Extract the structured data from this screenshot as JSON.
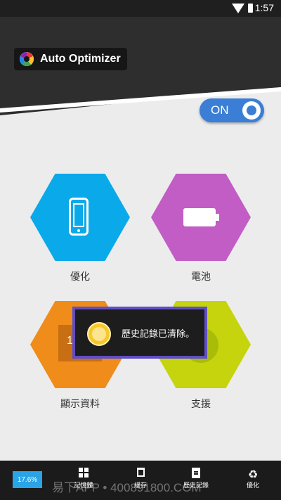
{
  "status_bar": {
    "time": "1:57",
    "wifi_icon": "wifi-icon",
    "battery_icon": "battery-icon"
  },
  "header": {
    "app_title": "Auto Optimizer",
    "logo_icon": "app-logo-icon"
  },
  "toggle": {
    "label": "ON",
    "state": "on"
  },
  "tiles": [
    {
      "label": "優化",
      "icon": "phone-icon",
      "color": "#0aa9ea"
    },
    {
      "label": "電池",
      "icon": "battery-icon",
      "color": "#c15dc5"
    },
    {
      "label": "顯示資料",
      "icon": "display-icon",
      "color": "#f08c1a",
      "icon_text": "1"
    },
    {
      "label": "支援",
      "icon": "support-icon",
      "color": "#c5d40d"
    }
  ],
  "toast": {
    "text": "歷史記錄已清除。",
    "icon": "emoji-face-icon"
  },
  "bottom_nav": {
    "usage_percent": "17.6%",
    "items": [
      {
        "label": "記憶體",
        "icon": "grid-icon"
      },
      {
        "label": "緩存",
        "icon": "trash-icon"
      },
      {
        "label": "歷史記錄",
        "icon": "document-icon"
      },
      {
        "label": "優化",
        "icon": "recycle-icon"
      }
    ],
    "watermark": "易下APP • 400891800.COM"
  }
}
